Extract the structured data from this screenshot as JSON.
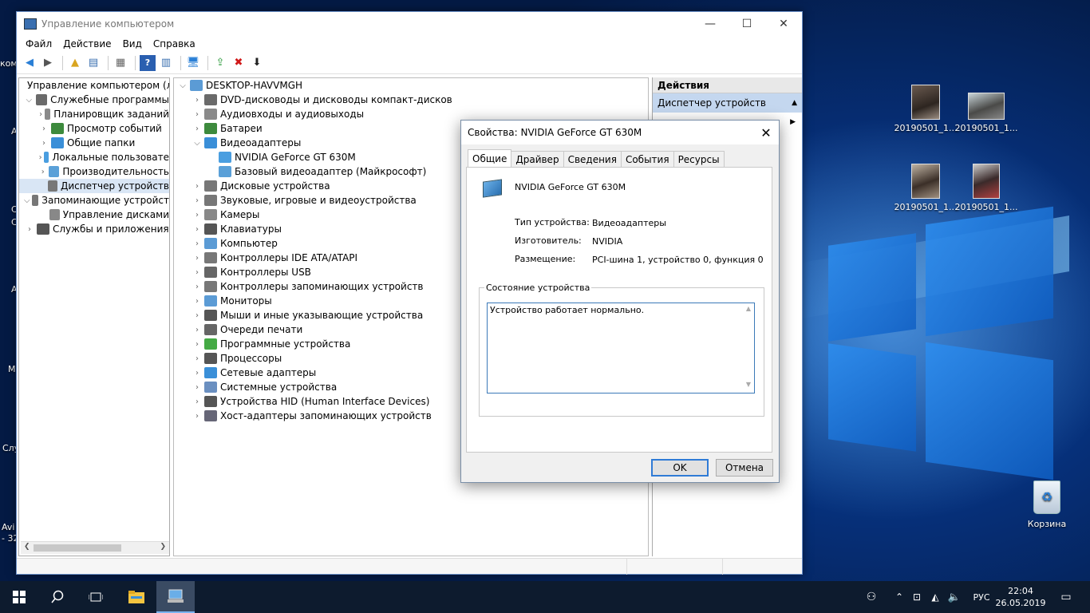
{
  "window": {
    "title": "Управление компьютером",
    "min": "—",
    "max": "☐",
    "close": "✕"
  },
  "menu": [
    "Файл",
    "Действие",
    "Вид",
    "Справка"
  ],
  "left_tree": {
    "root": "Управление компьютером (л",
    "items": [
      {
        "label": "Служебные программы",
        "level": 1,
        "chev": "⌵"
      },
      {
        "label": "Планировщик заданий",
        "level": 2,
        "chev": "›"
      },
      {
        "label": "Просмотр событий",
        "level": 2,
        "chev": "›"
      },
      {
        "label": "Общие папки",
        "level": 2,
        "chev": "›"
      },
      {
        "label": "Локальные пользовате",
        "level": 2,
        "chev": "›"
      },
      {
        "label": "Производительность",
        "level": 2,
        "chev": "›"
      },
      {
        "label": "Диспетчер устройств",
        "level": 2,
        "chev": "",
        "selected": true
      },
      {
        "label": "Запоминающие устройст",
        "level": 1,
        "chev": "⌵"
      },
      {
        "label": "Управление дисками",
        "level": 2,
        "chev": ""
      },
      {
        "label": "Службы и приложения",
        "level": 1,
        "chev": "›"
      }
    ]
  },
  "device_tree": {
    "root": "DESKTOP-HAVVMGH",
    "items": [
      {
        "label": "DVD-дисководы и дисководы компакт-дисков",
        "level": 1,
        "chev": "›"
      },
      {
        "label": "Аудиовходы и аудиовыходы",
        "level": 1,
        "chev": "›"
      },
      {
        "label": "Батареи",
        "level": 1,
        "chev": "›"
      },
      {
        "label": "Видеоадаптеры",
        "level": 1,
        "chev": "⌵"
      },
      {
        "label": "NVIDIA GeForce GT 630M",
        "level": 2,
        "chev": ""
      },
      {
        "label": "Базовый видеоадаптер (Майкрософт)",
        "level": 2,
        "chev": ""
      },
      {
        "label": "Дисковые устройства",
        "level": 1,
        "chev": "›"
      },
      {
        "label": "Звуковые, игровые и видеоустройства",
        "level": 1,
        "chev": "›"
      },
      {
        "label": "Камеры",
        "level": 1,
        "chev": "›"
      },
      {
        "label": "Клавиатуры",
        "level": 1,
        "chev": "›"
      },
      {
        "label": "Компьютер",
        "level": 1,
        "chev": "›"
      },
      {
        "label": "Контроллеры IDE ATA/ATAPI",
        "level": 1,
        "chev": "›"
      },
      {
        "label": "Контроллеры USB",
        "level": 1,
        "chev": "›"
      },
      {
        "label": "Контроллеры запоминающих устройств",
        "level": 1,
        "chev": "›"
      },
      {
        "label": "Мониторы",
        "level": 1,
        "chev": "›"
      },
      {
        "label": "Мыши и иные указывающие устройства",
        "level": 1,
        "chev": "›"
      },
      {
        "label": "Очереди печати",
        "level": 1,
        "chev": "›"
      },
      {
        "label": "Программные устройства",
        "level": 1,
        "chev": "›"
      },
      {
        "label": "Процессоры",
        "level": 1,
        "chev": "›"
      },
      {
        "label": "Сетевые адаптеры",
        "level": 1,
        "chev": "›"
      },
      {
        "label": "Системные устройства",
        "level": 1,
        "chev": "›"
      },
      {
        "label": "Устройства HID (Human Interface Devices)",
        "level": 1,
        "chev": "›"
      },
      {
        "label": "Хост-адаптеры запоминающих устройств",
        "level": 1,
        "chev": "›"
      }
    ]
  },
  "actions": {
    "header": "Действия",
    "sub": "Диспетчер устройств",
    "sub_arrow": "▲",
    "more_arrow": "▶"
  },
  "dialog": {
    "title": "Свойства: NVIDIA GeForce GT 630M",
    "close": "✕",
    "tabs": [
      "Общие",
      "Драйвер",
      "Сведения",
      "События",
      "Ресурсы"
    ],
    "device_name": "NVIDIA GeForce GT 630M",
    "props": [
      {
        "key": "Тип устройства:",
        "value": "Видеоадаптеры"
      },
      {
        "key": "Изготовитель:",
        "value": "NVIDIA"
      },
      {
        "key": "Размещение:",
        "value": "PCI-шина 1, устройство 0, функция 0"
      }
    ],
    "status_legend": "Состояние устройства",
    "status_text": "Устройство работает нормально.",
    "ok": "OK",
    "cancel": "Отмена"
  },
  "desktop": {
    "icons": [
      {
        "label": "20190501_1..."
      },
      {
        "label": "20190501_1..."
      },
      {
        "label": "20190501_1..."
      },
      {
        "label": "20190501_1..."
      }
    ],
    "recycle_bin": "Корзина",
    "edge_labels": [
      "ком",
      "A",
      "C",
      "C",
      "A",
      "M",
      "Слу",
      "Avi",
      "- 32"
    ]
  },
  "taskbar": {
    "lang": "РУС",
    "time": "22:04",
    "date": "26.05.2019"
  },
  "colors": {
    "accent": "#0078d7",
    "selection": "#d9e6f5",
    "actions_sub": "#c4d7ef"
  }
}
